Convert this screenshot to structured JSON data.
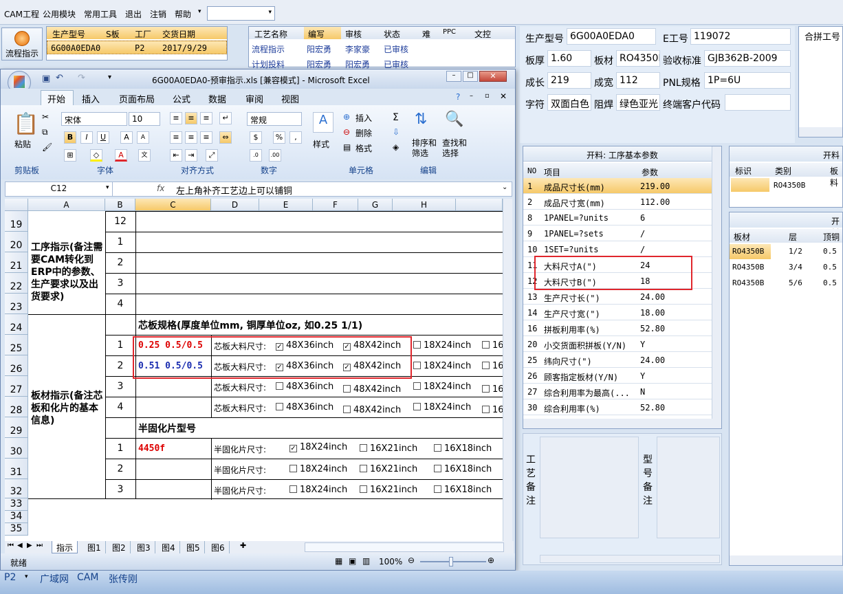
{
  "menu": [
    "CAM工程",
    "公用模块",
    "常用工具",
    "退出",
    "注销",
    "帮助"
  ],
  "flow_button": "流程指示",
  "grid1": {
    "headers": [
      "生产型号",
      "S板",
      "工厂",
      "交货日期"
    ],
    "row": [
      "6G00A0EDA0",
      "",
      "P2",
      "2017/9/29"
    ]
  },
  "grid2": {
    "headers": [
      "工艺名称",
      "编写",
      "审核",
      "状态",
      "难",
      "PPC",
      "文控"
    ],
    "rows": [
      [
        "流程指示",
        "阳宏勇",
        "李家豪",
        "已审核"
      ],
      [
        "计划投料",
        "阳宏勇",
        "阳宏勇",
        "已审核"
      ]
    ]
  },
  "info": {
    "labels": [
      "生产型号",
      "E工号",
      "板厚",
      "板材",
      "验收标准",
      "成长",
      "成宽",
      "PNL规格",
      "字符",
      "阻焊",
      "终端客户代码"
    ],
    "values": [
      "6G00A0EDA0",
      "119072",
      "1.60",
      "RO4350B",
      "GJB362B-2009",
      "219",
      "112",
      "1P=6U",
      "双面白色",
      "绿色亚光",
      ""
    ]
  },
  "hepin": "合拼工号",
  "param": {
    "title": "开料: 工序基本参数",
    "headers": [
      "NO",
      "项目",
      "参数"
    ],
    "rows": [
      [
        "1",
        "成品尺寸长(mm)",
        "219.00"
      ],
      [
        "2",
        "成品尺寸宽(mm)",
        "112.00"
      ],
      [
        "8",
        "1PANEL=?units",
        "6"
      ],
      [
        "9",
        "1PANEL=?sets",
        "/"
      ],
      [
        "10",
        "1SET=?units",
        "/"
      ],
      [
        "11",
        "大料尺寸A(\")",
        "24"
      ],
      [
        "12",
        "大料尺寸B(\")",
        "18"
      ],
      [
        "13",
        "生产尺寸长(\")",
        "24.00"
      ],
      [
        "14",
        "生产尺寸宽(\")",
        "18.00"
      ],
      [
        "16",
        "拼板利用率(%)",
        "52.80"
      ],
      [
        "20",
        "小交货面积拼板(Y/N)",
        "Y"
      ],
      [
        "25",
        "纬向尺寸(\")",
        "24.00"
      ],
      [
        "26",
        "顾客指定板材(Y/N)",
        "Y"
      ],
      [
        "27",
        "综合利用率为最高(...",
        "N"
      ],
      [
        "30",
        "综合利用率(%)",
        "52.80"
      ]
    ]
  },
  "right_top": {
    "title": "开料",
    "headers": [
      "标识",
      "类别",
      "板料"
    ],
    "row": [
      "",
      "RO4350B",
      ""
    ]
  },
  "right_bottom": {
    "title": "开料",
    "headers": [
      "板材",
      "层",
      "顶铜"
    ],
    "rows": [
      [
        "RO4350B",
        "1/2",
        "0.5"
      ],
      [
        "RO4350B",
        "3/4",
        "0.5"
      ],
      [
        "RO4350B",
        "5/6",
        "0.5"
      ]
    ]
  },
  "notes": {
    "left": "工艺备注",
    "right": "型号备注"
  },
  "excel": {
    "title": "6G00A0EDA0-预审指示.xls [兼容模式] - Microsoft Excel",
    "tabs": [
      "开始",
      "插入",
      "页面布局",
      "公式",
      "数据",
      "审阅",
      "视图"
    ],
    "font": "宋体",
    "size": "10",
    "numfmt": "常规",
    "groups": [
      "剪贴板",
      "字体",
      "对齐方式",
      "数字",
      "单元格",
      "编辑"
    ],
    "buttons": {
      "paste": "粘贴",
      "style": "样式",
      "insert": "插入",
      "delete": "删除",
      "format": "格式",
      "sort": "排序和筛选",
      "find": "查找和选择"
    },
    "namebox": "C12",
    "formula": "左上角补齐工艺边上可以铺铜",
    "cols": [
      "A",
      "B",
      "C",
      "D",
      "E",
      "F",
      "G",
      "H"
    ],
    "rows": [
      "19",
      "20",
      "21",
      "22",
      "23",
      "24",
      "25",
      "26",
      "27",
      "28",
      "29",
      "30",
      "31",
      "32",
      "33",
      "34",
      "35"
    ],
    "process_label": "工序指示(备注需要CAM转化到ERP中的参数、生产要求以及出货要求)",
    "board_label": "板材指示(备注芯板和化片的基本信息)",
    "b_nums": [
      "12",
      "1",
      "2",
      "3",
      "4",
      "1",
      "2",
      "3",
      "4",
      "1",
      "2",
      "3"
    ],
    "core_title": "芯板规格(厚度单位mm, 铜厚单位oz, 如0.25 1/1)",
    "core_vals": [
      "0.25 0.5/0.5",
      "0.51 0.5/0.5"
    ],
    "core_label": "芯板大料尺寸:",
    "core_sizes": [
      "48X36inch",
      "48X42inch",
      "18X24inch",
      "16"
    ],
    "pp_title": "半固化片型号",
    "pp_val": "4450f",
    "pp_label": "半固化片尺寸:",
    "pp_sizes": [
      "18X24inch",
      "16X21inch",
      "16X18inch"
    ],
    "sheets": [
      "指示",
      "图1",
      "图2",
      "图3",
      "图4",
      "图5",
      "图6"
    ],
    "status": "就绪",
    "zoom": "100%"
  },
  "taskbar": [
    "P2",
    "广域网",
    "CAM",
    "张传刚"
  ]
}
